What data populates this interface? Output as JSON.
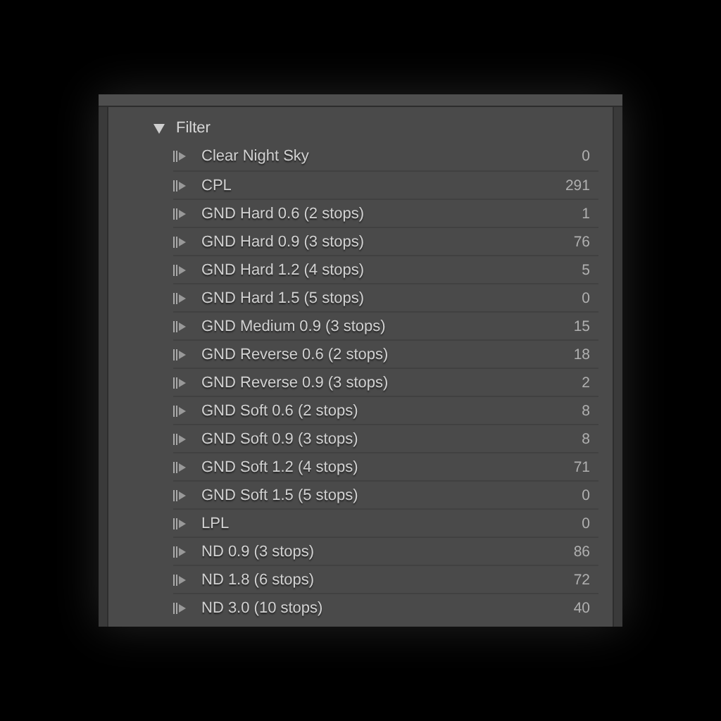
{
  "group": {
    "label": "Filter",
    "expanded": true,
    "items": [
      {
        "label": "Clear Night Sky",
        "count": "0"
      },
      {
        "label": "CPL",
        "count": "291"
      },
      {
        "label": "GND Hard 0.6 (2 stops)",
        "count": "1"
      },
      {
        "label": "GND Hard 0.9 (3 stops)",
        "count": "76"
      },
      {
        "label": "GND Hard 1.2 (4 stops)",
        "count": "5"
      },
      {
        "label": "GND Hard 1.5 (5 stops)",
        "count": "0"
      },
      {
        "label": "GND Medium 0.9 (3 stops)",
        "count": "15"
      },
      {
        "label": "GND Reverse 0.6 (2 stops)",
        "count": "18"
      },
      {
        "label": "GND Reverse 0.9 (3 stops)",
        "count": "2"
      },
      {
        "label": "GND Soft 0.6 (2 stops)",
        "count": "8"
      },
      {
        "label": "GND Soft 0.9 (3 stops)",
        "count": "8"
      },
      {
        "label": "GND Soft 1.2 (4 stops)",
        "count": "71"
      },
      {
        "label": "GND Soft 1.5 (5 stops)",
        "count": "0"
      },
      {
        "label": "LPL",
        "count": "0"
      },
      {
        "label": "ND 0.9 (3 stops)",
        "count": "86"
      },
      {
        "label": "ND 1.8 (6 stops)",
        "count": "72"
      },
      {
        "label": "ND 3.0 (10 stops)",
        "count": "40"
      }
    ]
  }
}
